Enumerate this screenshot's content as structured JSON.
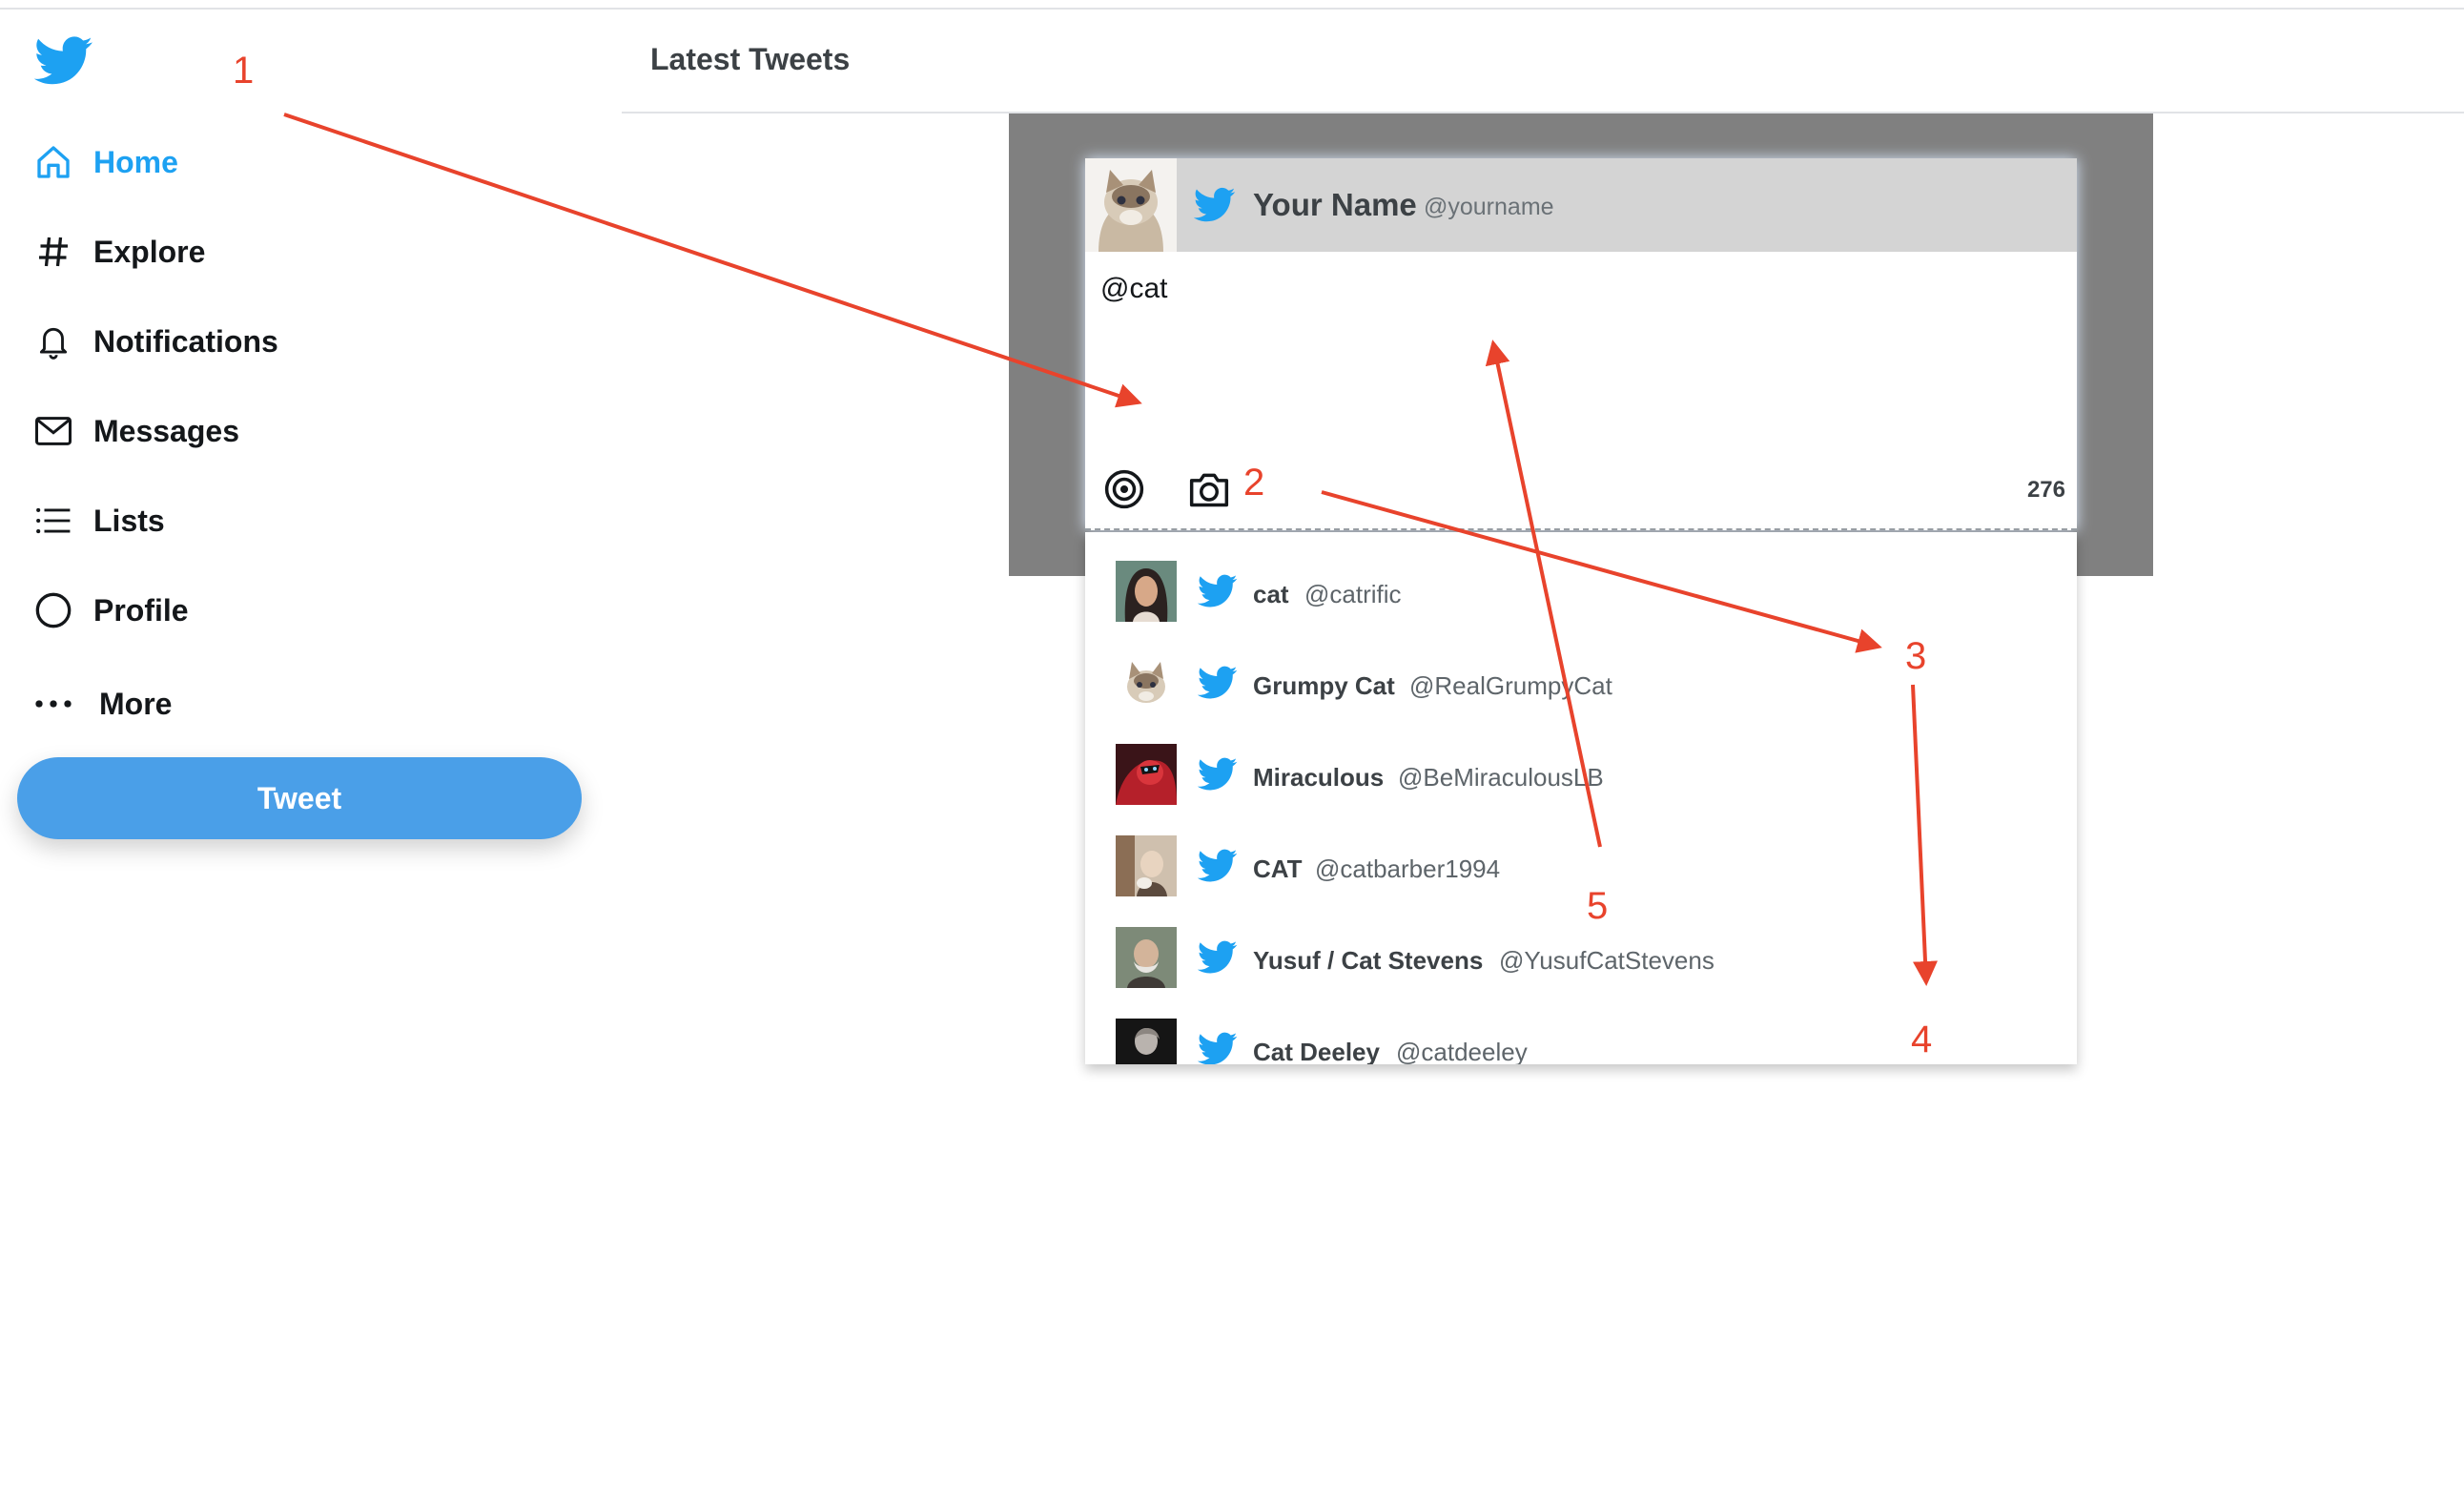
{
  "colors": {
    "brand": "#1da1f2",
    "button": "#4a9fe8",
    "annotation": "#e8432c",
    "overlay": "#808080"
  },
  "sidebar": {
    "logo": "twitter-bird-icon",
    "items": [
      {
        "label": "Home",
        "icon": "home-icon",
        "active": true
      },
      {
        "label": "Explore",
        "icon": "hashtag-icon"
      },
      {
        "label": "Notifications",
        "icon": "bell-icon"
      },
      {
        "label": "Messages",
        "icon": "envelope-icon"
      },
      {
        "label": "Lists",
        "icon": "list-icon"
      },
      {
        "label": "Profile",
        "icon": "circle-icon"
      },
      {
        "label": "More",
        "icon": "more-dots-icon"
      }
    ],
    "tweet_button": "Tweet"
  },
  "header": {
    "title": "Latest Tweets"
  },
  "compose": {
    "name": "Your Name",
    "handle": "@yourname",
    "text": "@cat",
    "char_count": "276",
    "tools": [
      "target-icon",
      "camera-icon"
    ]
  },
  "suggestions": [
    {
      "name": "cat",
      "handle": "@catrific"
    },
    {
      "name": "Grumpy Cat",
      "handle": "@RealGrumpyCat"
    },
    {
      "name": "Miraculous",
      "handle": "@BeMiraculousLB"
    },
    {
      "name": "CAT",
      "handle": "@catbarber1994"
    },
    {
      "name": "Yusuf / Cat Stevens",
      "handle": "@YusufCatStevens"
    },
    {
      "name": "Cat Deeley",
      "handle": "@catdeeley"
    }
  ],
  "annotations": [
    "1",
    "2",
    "3",
    "4",
    "5"
  ]
}
